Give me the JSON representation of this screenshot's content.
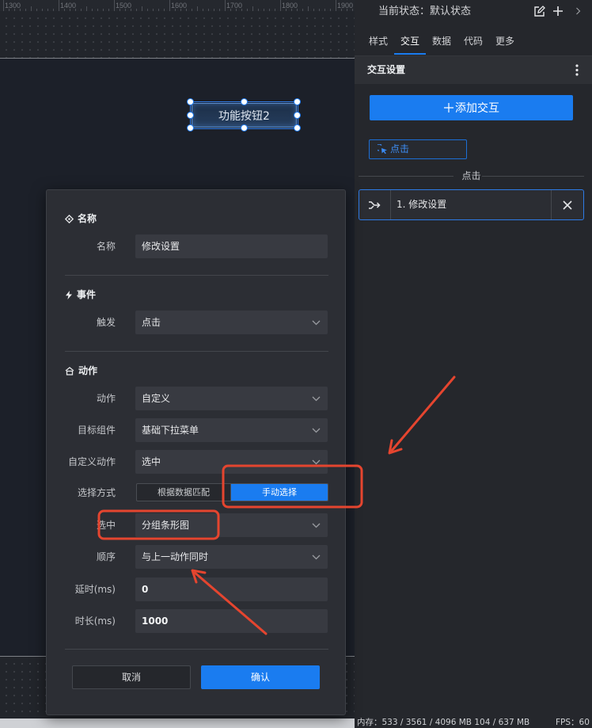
{
  "colors": {
    "accent": "#1a7cf0",
    "annotation": "#e5452f"
  },
  "ruler": {
    "labels": [
      "1300",
      "1400",
      "1500",
      "1600",
      "1700",
      "1800",
      "1900"
    ]
  },
  "canvas": {
    "selected_widget": {
      "label": "功能按钮2"
    }
  },
  "panel": {
    "status": {
      "label": "当前状态：",
      "value": "默认状态"
    },
    "toolbar_icons": [
      "edit-icon",
      "plus-icon",
      "chevron-right-icon"
    ],
    "tabs": [
      {
        "label": "样式"
      },
      {
        "label": "交互",
        "active": true
      },
      {
        "label": "数据"
      },
      {
        "label": "代码"
      },
      {
        "label": "更多"
      }
    ],
    "section_title": "交互设置",
    "add_button": {
      "icon": "plus-icon",
      "label": "添加交互"
    },
    "trigger_chip": {
      "icon": "cursor-click-icon",
      "label": "点击"
    },
    "group_label": "点击",
    "interactions": [
      {
        "icon": "merge-arrow-icon",
        "label": "1. 修改设置"
      }
    ]
  },
  "dialog": {
    "name_section": {
      "icon": "diamond-icon",
      "title": "名称",
      "name": {
        "label": "名称",
        "value": "修改设置"
      }
    },
    "event_section": {
      "icon": "lightning-icon",
      "title": "事件",
      "trigger": {
        "label": "触发",
        "value": "点击"
      }
    },
    "action_section": {
      "icon": "house-icon",
      "title": "动作",
      "action": {
        "label": "动作",
        "value": "自定义"
      },
      "target": {
        "label": "目标组件",
        "value": "基础下拉菜单"
      },
      "custom_action": {
        "label": "自定义动作",
        "value": "选中"
      },
      "select_mode": {
        "label": "选择方式",
        "options": [
          "根据数据匹配",
          "手动选择"
        ],
        "selected_index": 1
      },
      "selected": {
        "label": "选中",
        "value": "分组条形图"
      },
      "order": {
        "label": "顺序",
        "value": "与上一动作同时"
      },
      "delay": {
        "label": "延时(ms)",
        "value": "0"
      },
      "duration": {
        "label": "时长(ms)",
        "value": "1000"
      }
    },
    "cancel_label": "取消",
    "confirm_label": "确认"
  },
  "statusbar": {
    "memory": "内存：533 / 3561 / 4096 MB",
    "memory_secondary": "104 / 637 MB",
    "fps": "FPS：60"
  }
}
